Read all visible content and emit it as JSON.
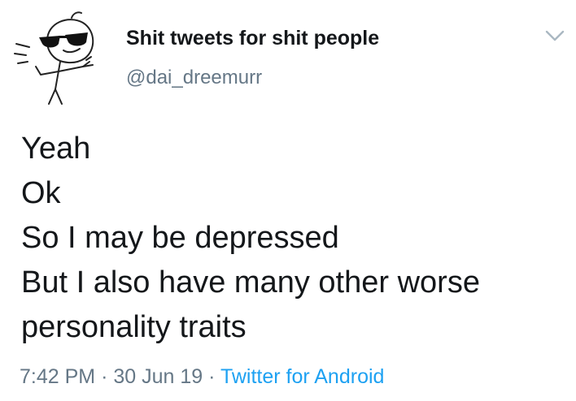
{
  "tweet": {
    "author": {
      "display_name": "Shit tweets for shit people",
      "handle": "@dai_dreemurr",
      "avatar_icon": "sunglasses-stickfigure-avatar"
    },
    "menu_icon": "chevron-down-icon",
    "body_lines": [
      "Yeah",
      "Ok",
      "So I may be depressed",
      "But I also have many other worse",
      "personality traits"
    ],
    "meta": {
      "time": "7:42 PM",
      "separator": "·",
      "date": "30 Jun 19",
      "source": "Twitter for Android"
    },
    "colors": {
      "text": "#14171a",
      "secondary": "#657786",
      "link": "#1da1f2",
      "chevron": "#aab8c2"
    }
  }
}
